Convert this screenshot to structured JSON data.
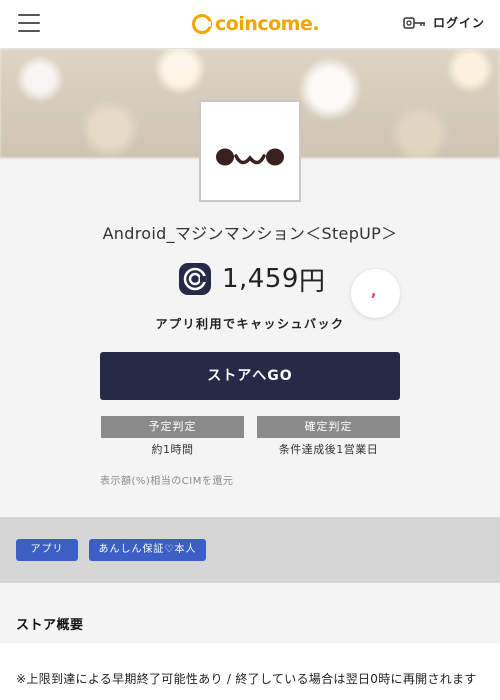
{
  "header": {
    "logo_text": "coincome.",
    "login_label": "ログイン"
  },
  "app": {
    "icon_face": "•ᴗ•",
    "name": "Android_マジンマンション＜StepUP＞",
    "price_value": "1,459",
    "price_unit": "円",
    "cashback_label": "アプリ利用でキャッシュバック"
  },
  "actions": {
    "store_button": "ストアへGO",
    "favorite_glyph": ","
  },
  "judgement": {
    "scheduled_label": "予定判定",
    "scheduled_value": "約1時間",
    "confirmed_label": "確定判定",
    "confirmed_value": "条件達成後1営業日"
  },
  "note": "表示額(%)相当のCIMを還元",
  "tags": [
    "アプリ",
    "あんしん保証♡本人"
  ],
  "section": {
    "title": "ストア概要",
    "body": "※上限到達による早期終了可能性あり / 終了している場合は翌日0時に再開されます"
  },
  "colors": {
    "brand": "#f0a500",
    "primary_button": "#262a46",
    "tag": "#3b5fc4",
    "judge_tag": "#8a8a8a"
  }
}
